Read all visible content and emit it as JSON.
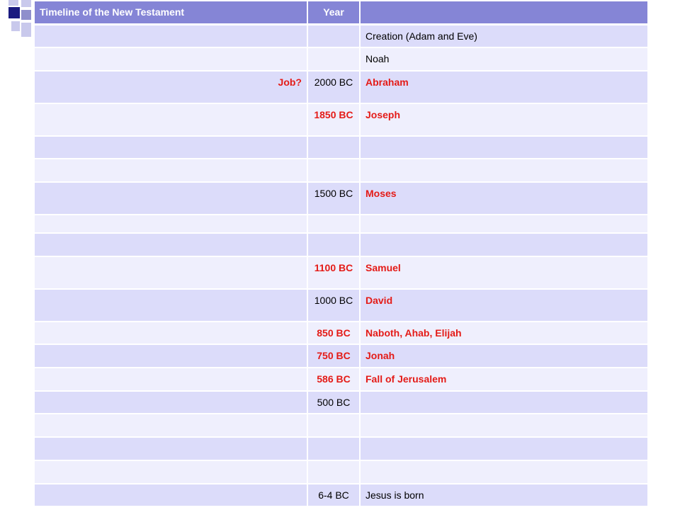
{
  "header": {
    "col1": "Timeline of the New Testament",
    "col2": "Year",
    "col3": ""
  },
  "rows": [
    {
      "c1": "",
      "c2": "",
      "c3": "Creation (Adam and Eve)",
      "c1_red": false,
      "c2_red": false,
      "c3_red": false,
      "h": 32
    },
    {
      "c1": "",
      "c2": "",
      "c3": "Noah",
      "c1_red": false,
      "c2_red": false,
      "c3_red": false,
      "h": 33
    },
    {
      "c1": "Job?",
      "c2": "2000 BC",
      "c3": "Abraham",
      "c1_red": true,
      "c2_red": false,
      "c3_red": true,
      "h": 46
    },
    {
      "c1": "",
      "c2": "1850 BC",
      "c3": "Joseph",
      "c1_red": false,
      "c2_red": true,
      "c3_red": true,
      "h": 46
    },
    {
      "c1": "",
      "c2": "",
      "c3": "",
      "c1_red": false,
      "c2_red": false,
      "c3_red": false,
      "h": 32
    },
    {
      "c1": "",
      "c2": "",
      "c3": "",
      "c1_red": false,
      "c2_red": false,
      "c3_red": false,
      "h": 33
    },
    {
      "c1": "",
      "c2": "1500 BC",
      "c3": "Moses",
      "c1_red": false,
      "c2_red": false,
      "c3_red": true,
      "h": 46
    },
    {
      "c1": "",
      "c2": "",
      "c3": "",
      "c1_red": false,
      "c2_red": false,
      "c3_red": false,
      "h": 26
    },
    {
      "c1": "",
      "c2": "",
      "c3": "",
      "c1_red": false,
      "c2_red": false,
      "c3_red": false,
      "h": 33
    },
    {
      "c1": "",
      "c2": "1100 BC",
      "c3": "Samuel",
      "c1_red": false,
      "c2_red": true,
      "c3_red": true,
      "h": 46
    },
    {
      "c1": "",
      "c2": "1000 BC",
      "c3": "David",
      "c1_red": false,
      "c2_red": false,
      "c3_red": true,
      "h": 46
    },
    {
      "c1": "",
      "c2": "850 BC",
      "c3": "Naboth, Ahab, Elijah",
      "c1_red": false,
      "c2_red": true,
      "c3_red": true,
      "h": 32
    },
    {
      "c1": "",
      "c2": "750 BC",
      "c3": "Jonah",
      "c1_red": false,
      "c2_red": true,
      "c3_red": true,
      "h": 33
    },
    {
      "c1": "",
      "c2": "586 BC",
      "c3": "Fall of Jerusalem",
      "c1_red": false,
      "c2_red": true,
      "c3_red": true,
      "h": 33
    },
    {
      "c1": "",
      "c2": "500 BC",
      "c3": "",
      "c1_red": false,
      "c2_red": false,
      "c3_red": false,
      "h": 32
    },
    {
      "c1": "",
      "c2": "",
      "c3": "",
      "c1_red": false,
      "c2_red": false,
      "c3_red": false,
      "h": 33
    },
    {
      "c1": "",
      "c2": "",
      "c3": "",
      "c1_red": false,
      "c2_red": false,
      "c3_red": false,
      "h": 33
    },
    {
      "c1": "",
      "c2": "",
      "c3": "",
      "c1_red": false,
      "c2_red": false,
      "c3_red": false,
      "h": 33
    },
    {
      "c1": "",
      "c2": "6-4 BC",
      "c3": "Jesus is born",
      "c1_red": false,
      "c2_red": false,
      "c3_red": false,
      "h": 32
    }
  ],
  "colors": {
    "header_bg": "#8585d6",
    "row_dark": "#dcdcfa",
    "row_light": "#efeffd",
    "highlight_red": "#e41b17"
  }
}
